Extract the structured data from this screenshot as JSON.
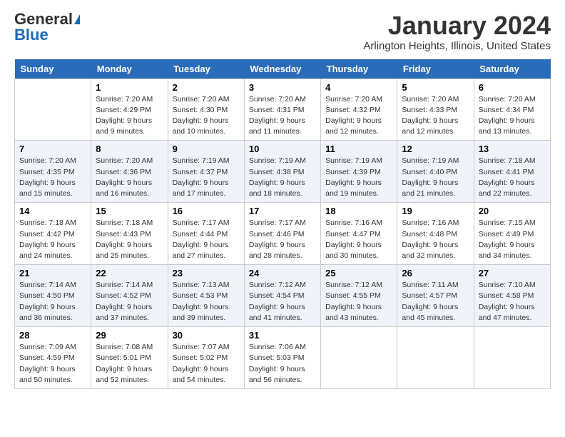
{
  "logo": {
    "general": "General",
    "blue": "Blue"
  },
  "title": "January 2024",
  "location": "Arlington Heights, Illinois, United States",
  "days_header": [
    "Sunday",
    "Monday",
    "Tuesday",
    "Wednesday",
    "Thursday",
    "Friday",
    "Saturday"
  ],
  "weeks": [
    [
      {
        "num": "",
        "info": ""
      },
      {
        "num": "1",
        "info": "Sunrise: 7:20 AM\nSunset: 4:29 PM\nDaylight: 9 hours\nand 9 minutes."
      },
      {
        "num": "2",
        "info": "Sunrise: 7:20 AM\nSunset: 4:30 PM\nDaylight: 9 hours\nand 10 minutes."
      },
      {
        "num": "3",
        "info": "Sunrise: 7:20 AM\nSunset: 4:31 PM\nDaylight: 9 hours\nand 11 minutes."
      },
      {
        "num": "4",
        "info": "Sunrise: 7:20 AM\nSunset: 4:32 PM\nDaylight: 9 hours\nand 12 minutes."
      },
      {
        "num": "5",
        "info": "Sunrise: 7:20 AM\nSunset: 4:33 PM\nDaylight: 9 hours\nand 12 minutes."
      },
      {
        "num": "6",
        "info": "Sunrise: 7:20 AM\nSunset: 4:34 PM\nDaylight: 9 hours\nand 13 minutes."
      }
    ],
    [
      {
        "num": "7",
        "info": "Sunrise: 7:20 AM\nSunset: 4:35 PM\nDaylight: 9 hours\nand 15 minutes."
      },
      {
        "num": "8",
        "info": "Sunrise: 7:20 AM\nSunset: 4:36 PM\nDaylight: 9 hours\nand 16 minutes."
      },
      {
        "num": "9",
        "info": "Sunrise: 7:19 AM\nSunset: 4:37 PM\nDaylight: 9 hours\nand 17 minutes."
      },
      {
        "num": "10",
        "info": "Sunrise: 7:19 AM\nSunset: 4:38 PM\nDaylight: 9 hours\nand 18 minutes."
      },
      {
        "num": "11",
        "info": "Sunrise: 7:19 AM\nSunset: 4:39 PM\nDaylight: 9 hours\nand 19 minutes."
      },
      {
        "num": "12",
        "info": "Sunrise: 7:19 AM\nSunset: 4:40 PM\nDaylight: 9 hours\nand 21 minutes."
      },
      {
        "num": "13",
        "info": "Sunrise: 7:18 AM\nSunset: 4:41 PM\nDaylight: 9 hours\nand 22 minutes."
      }
    ],
    [
      {
        "num": "14",
        "info": "Sunrise: 7:18 AM\nSunset: 4:42 PM\nDaylight: 9 hours\nand 24 minutes."
      },
      {
        "num": "15",
        "info": "Sunrise: 7:18 AM\nSunset: 4:43 PM\nDaylight: 9 hours\nand 25 minutes."
      },
      {
        "num": "16",
        "info": "Sunrise: 7:17 AM\nSunset: 4:44 PM\nDaylight: 9 hours\nand 27 minutes."
      },
      {
        "num": "17",
        "info": "Sunrise: 7:17 AM\nSunset: 4:46 PM\nDaylight: 9 hours\nand 28 minutes."
      },
      {
        "num": "18",
        "info": "Sunrise: 7:16 AM\nSunset: 4:47 PM\nDaylight: 9 hours\nand 30 minutes."
      },
      {
        "num": "19",
        "info": "Sunrise: 7:16 AM\nSunset: 4:48 PM\nDaylight: 9 hours\nand 32 minutes."
      },
      {
        "num": "20",
        "info": "Sunrise: 7:15 AM\nSunset: 4:49 PM\nDaylight: 9 hours\nand 34 minutes."
      }
    ],
    [
      {
        "num": "21",
        "info": "Sunrise: 7:14 AM\nSunset: 4:50 PM\nDaylight: 9 hours\nand 36 minutes."
      },
      {
        "num": "22",
        "info": "Sunrise: 7:14 AM\nSunset: 4:52 PM\nDaylight: 9 hours\nand 37 minutes."
      },
      {
        "num": "23",
        "info": "Sunrise: 7:13 AM\nSunset: 4:53 PM\nDaylight: 9 hours\nand 39 minutes."
      },
      {
        "num": "24",
        "info": "Sunrise: 7:12 AM\nSunset: 4:54 PM\nDaylight: 9 hours\nand 41 minutes."
      },
      {
        "num": "25",
        "info": "Sunrise: 7:12 AM\nSunset: 4:55 PM\nDaylight: 9 hours\nand 43 minutes."
      },
      {
        "num": "26",
        "info": "Sunrise: 7:11 AM\nSunset: 4:57 PM\nDaylight: 9 hours\nand 45 minutes."
      },
      {
        "num": "27",
        "info": "Sunrise: 7:10 AM\nSunset: 4:58 PM\nDaylight: 9 hours\nand 47 minutes."
      }
    ],
    [
      {
        "num": "28",
        "info": "Sunrise: 7:09 AM\nSunset: 4:59 PM\nDaylight: 9 hours\nand 50 minutes."
      },
      {
        "num": "29",
        "info": "Sunrise: 7:08 AM\nSunset: 5:01 PM\nDaylight: 9 hours\nand 52 minutes."
      },
      {
        "num": "30",
        "info": "Sunrise: 7:07 AM\nSunset: 5:02 PM\nDaylight: 9 hours\nand 54 minutes."
      },
      {
        "num": "31",
        "info": "Sunrise: 7:06 AM\nSunset: 5:03 PM\nDaylight: 9 hours\nand 56 minutes."
      },
      {
        "num": "",
        "info": ""
      },
      {
        "num": "",
        "info": ""
      },
      {
        "num": "",
        "info": ""
      }
    ]
  ]
}
